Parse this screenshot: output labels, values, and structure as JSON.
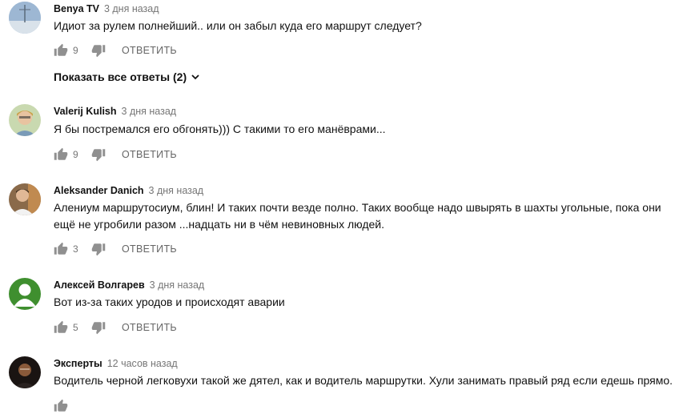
{
  "comments": [
    {
      "author": "Benya TV",
      "time": "3 дня назад",
      "lines": [
        "Идиот за рулем полнейший.. или он забыл куда его маршрут следует?"
      ],
      "likes": "9",
      "reply_label": "ОТВЕТИТЬ",
      "avatar": "landscape-avatar"
    },
    {
      "author": "Valerij Kulish",
      "time": "3 дня назад",
      "lines": [
        "Я бы пострем­ался его обгонять))) С такими то его манёврами..."
      ],
      "likes": "9",
      "reply_label": "ОТВЕТИТЬ",
      "avatar": "person-avatar"
    },
    {
      "author": "Aleksander Danich",
      "time": "3 дня назад",
      "lines": [
        "Алениум маршрутосиум, блин! И таких почти везде полно. Таких вообще надо швырять в шахты угольные, пока они",
        "ещё не угробили разом ...надцать ни в чём невиновных людей."
      ],
      "likes": "3",
      "reply_label": "ОТВЕТИТЬ",
      "avatar": "person-avatar"
    },
    {
      "author": "Алексей Волгарев",
      "time": "3 дня назад",
      "lines": [
        "Вот из-за таких уродов и происходят аварии"
      ],
      "likes": "5",
      "reply_label": "ОТВЕТИТЬ",
      "avatar": "default-green-avatar"
    },
    {
      "author": "Эксперты",
      "time": "12 часов назад",
      "lines": [
        "Водитель черной легковухи такой же дятел, как и водитель маршрутки. Хули занимать правый ряд если едешь прямо."
      ],
      "likes": "",
      "reply_label": "",
      "avatar": "dark-avatar"
    }
  ],
  "show_replies_label": "Показать все ответы (2)",
  "colors": {
    "text": "#111111",
    "meta": "#767676",
    "icon": "#909090",
    "green_avatar": "#3f8f2f"
  }
}
